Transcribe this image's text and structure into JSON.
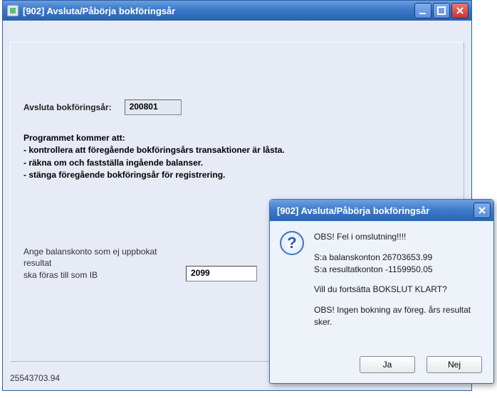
{
  "main_window": {
    "title": "[902]  Avsluta/Påbörja bokföringsår",
    "year_label": "Avsluta bokföringsår:",
    "year_value": "200801",
    "info_heading": "Programmet kommer att:",
    "info_lines": [
      " - kontrollera att föregående bokföringsårs transaktioner är låsta.",
      " - räkna om och fastställa ingående balanser.",
      " - stänga föregående bokföringsår för registrering."
    ],
    "acct_label_line1": "Ange balanskonto som ej uppbokat resultat",
    "acct_label_line2": "ska föras till som IB",
    "acct_value": "2099",
    "status": "25543703.94"
  },
  "dialog": {
    "title": "[902]  Avsluta/Påbörja bokföringsår",
    "heading": "OBS! Fel i omslutning!!!!",
    "line1": "S:a balanskonton 26703653.99",
    "line2": "S:a resultatkonton -1159950.05",
    "question": "Vill du fortsätta BOKSLUT KLART?",
    "note": "OBS! Ingen bokning av föreg. års resultat sker.",
    "yes": "Ja",
    "no": "Nej"
  }
}
